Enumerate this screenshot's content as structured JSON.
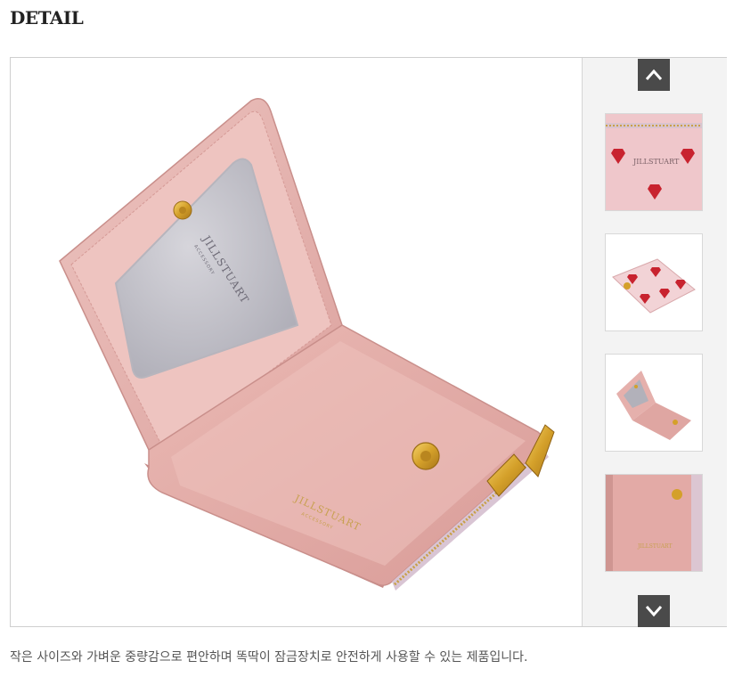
{
  "section": {
    "title": "DETAIL"
  },
  "main_image": {
    "alt": "JILLSTUART pink card wallet open",
    "brand_text": "JILLSTUART",
    "sub_text": "ACCESSORY"
  },
  "thumbnails": [
    {
      "name": "thumb-heart-print-closeup",
      "brand_text": "JILLSTUART"
    },
    {
      "name": "thumb-wallet-closed"
    },
    {
      "name": "thumb-wallet-open"
    },
    {
      "name": "thumb-inner-pocket"
    }
  ],
  "nav": {
    "up_icon": "chevron-up-icon",
    "down_icon": "chevron-down-icon"
  },
  "caption": "작은 사이즈와 가벼운 중량감으로 편안하며 똑딱이 잠금장치로 안전하게 사용할 수 있는 제품입니다.",
  "colors": {
    "wallet_pink": "#e8b6b2",
    "gold": "#d9a62a",
    "arrow_bg": "#4a4a4a"
  }
}
